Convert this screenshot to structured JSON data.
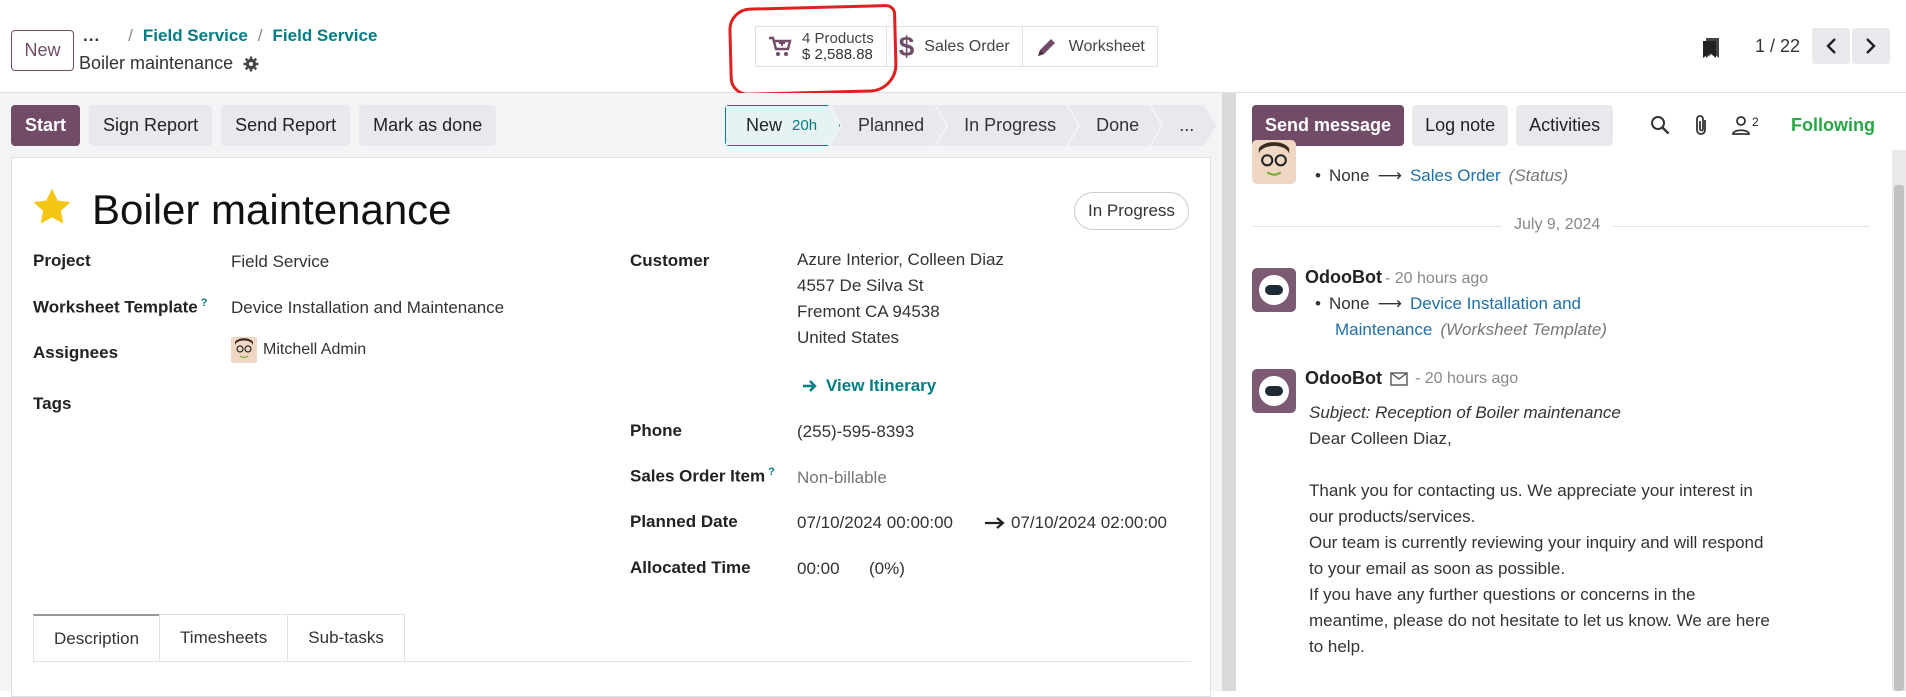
{
  "header": {
    "new_button": "New",
    "breadcrumb_dots": "...",
    "breadcrumb": [
      "Field Service",
      "Field Service"
    ],
    "record_name": "Boiler maintenance",
    "smart_buttons": {
      "products_count": "4 Products",
      "products_amount": "$ 2,588.88",
      "sales_order": "Sales Order",
      "worksheet": "Worksheet"
    },
    "pager": "1 / 22"
  },
  "actions": [
    "Start",
    "Sign Report",
    "Send Report",
    "Mark as done"
  ],
  "stages": [
    {
      "label": "New",
      "sub": "20h"
    },
    {
      "label": "Planned"
    },
    {
      "label": "In Progress"
    },
    {
      "label": "Done"
    },
    {
      "label": "..."
    }
  ],
  "form": {
    "title": "Boiler maintenance",
    "status_badge": "In Progress",
    "project_label": "Project",
    "project": "Field Service",
    "worksheet_template_label": "Worksheet Template",
    "worksheet_template": "Device Installation and Maintenance",
    "assignees_label": "Assignees",
    "assignee": "Mitchell Admin",
    "tags_label": "Tags",
    "customer_label": "Customer",
    "customer_name": "Azure Interior, Colleen Diaz",
    "customer_street": "4557 De Silva St",
    "customer_city": "Fremont CA 94538",
    "customer_country": "United States",
    "view_itinerary": "View Itinerary",
    "phone_label": "Phone",
    "phone": "(255)-595-8393",
    "so_item_label": "Sales Order Item",
    "so_item": "Non-billable",
    "planned_label": "Planned Date",
    "planned_start": "07/10/2024 00:00:00",
    "planned_end": "07/10/2024 02:00:00",
    "allocated_label": "Allocated Time",
    "allocated_time": "00:00",
    "allocated_pct": "(0%)",
    "tabs": [
      "Description",
      "Timesheets",
      "Sub-tasks"
    ]
  },
  "chatter": {
    "send_message": "Send message",
    "log_note": "Log note",
    "activities": "Activities",
    "followers_count": "2",
    "following": "Following",
    "msg1": {
      "none": "None",
      "value": "Sales Order",
      "field": "(Status)"
    },
    "date_separator": "July 9, 2024",
    "msg2": {
      "author": "OdooBot",
      "time": "- 20 hours ago",
      "none": "None",
      "value_line1": "Device Installation and",
      "value_line2": "Maintenance",
      "field": "(Worksheet Template)"
    },
    "msg3": {
      "author": "OdooBot",
      "time": "- 20 hours ago",
      "subject": "Subject: Reception of Boiler maintenance",
      "greeting": "Dear Colleen Diaz,",
      "line1": "Thank you for contacting us. We appreciate your interest in",
      "line2": "our products/services.",
      "line3": "Our team is currently reviewing your inquiry and will respond",
      "line4": "to your email as soon as possible.",
      "line5": "If you have any further questions or concerns in the",
      "line6": "meantime, please do not hesitate to let us know. We are here",
      "line7": "to help."
    }
  },
  "colors": {
    "brand": "#714b67",
    "teal": "#017e84",
    "following": "#28a745",
    "annotation": "#e02020"
  }
}
